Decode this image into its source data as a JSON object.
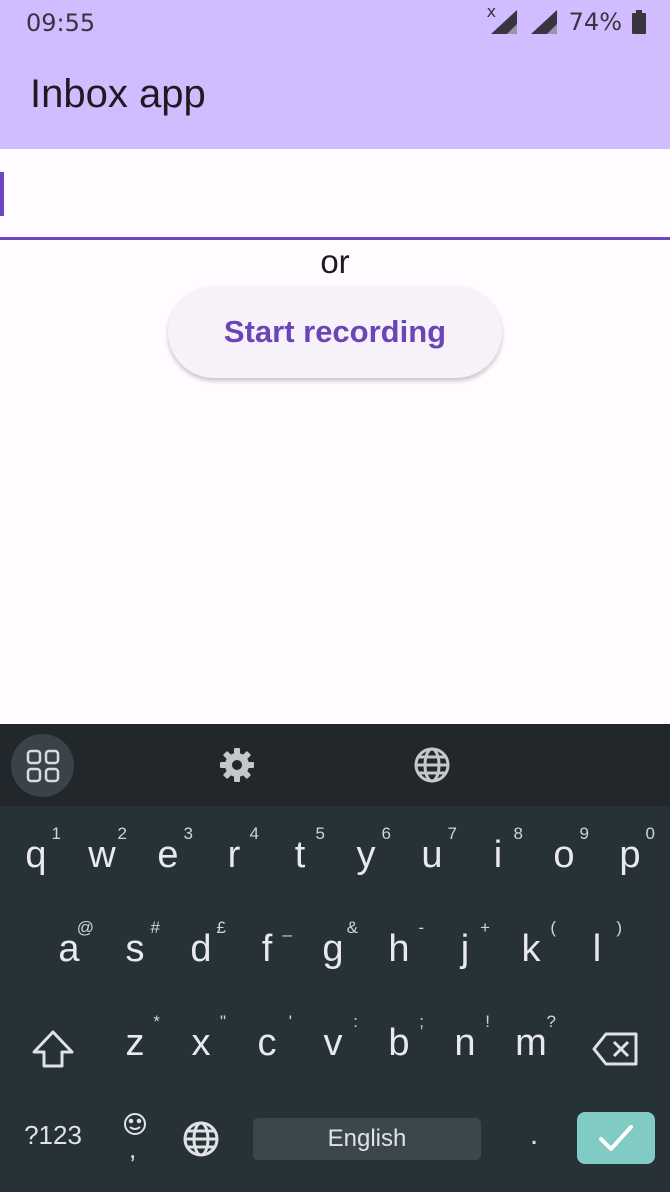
{
  "status_bar": {
    "time": "09:55",
    "battery": "74%"
  },
  "app_bar": {
    "title": "Inbox app"
  },
  "main": {
    "input": {
      "value": "",
      "placeholder": ""
    },
    "or_text": "or",
    "record_button": "Start recording"
  },
  "keyboard": {
    "row1": [
      {
        "key": "q",
        "hint": "1"
      },
      {
        "key": "w",
        "hint": "2"
      },
      {
        "key": "e",
        "hint": "3"
      },
      {
        "key": "r",
        "hint": "4"
      },
      {
        "key": "t",
        "hint": "5"
      },
      {
        "key": "y",
        "hint": "6"
      },
      {
        "key": "u",
        "hint": "7"
      },
      {
        "key": "i",
        "hint": "8"
      },
      {
        "key": "o",
        "hint": "9"
      },
      {
        "key": "p",
        "hint": "0"
      }
    ],
    "row2": [
      {
        "key": "a",
        "hint": "@"
      },
      {
        "key": "s",
        "hint": "#"
      },
      {
        "key": "d",
        "hint": "£"
      },
      {
        "key": "f",
        "hint": "_"
      },
      {
        "key": "g",
        "hint": "&"
      },
      {
        "key": "h",
        "hint": "-"
      },
      {
        "key": "j",
        "hint": "+"
      },
      {
        "key": "k",
        "hint": "("
      },
      {
        "key": "l",
        "hint": ")"
      }
    ],
    "row3": [
      {
        "key": "z",
        "hint": "*"
      },
      {
        "key": "x",
        "hint": "\""
      },
      {
        "key": "c",
        "hint": "'"
      },
      {
        "key": "v",
        "hint": ":"
      },
      {
        "key": "b",
        "hint": ";"
      },
      {
        "key": "n",
        "hint": "!"
      },
      {
        "key": "m",
        "hint": "?"
      }
    ],
    "symbols_label": "?123",
    "space_label": "English",
    "period_label": ".",
    "emoji_comma": ","
  },
  "colors": {
    "app_bar": "#d0bcff",
    "accent": "#6d47bf",
    "keyboard_bg": "#263238",
    "enter_key": "#80cbc4"
  },
  "icons": [
    "apps-grid-icon",
    "settings-gear-icon",
    "globe-icon",
    "shift-icon",
    "backspace-icon",
    "checkmark-icon",
    "emoji-icon",
    "signal-icon",
    "battery-icon"
  ]
}
